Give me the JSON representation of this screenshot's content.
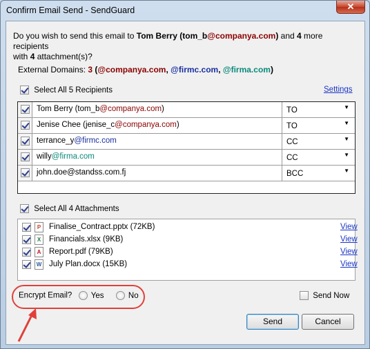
{
  "window": {
    "title": "Confirm Email Send - SendGuard",
    "close_glyph": "✕"
  },
  "prompt": {
    "pre": "Do you wish to send this email to ",
    "name": "Tom Berry",
    "open": " (tom_b",
    "domain": "@companya.com",
    "close": ")",
    "and": " and ",
    "count": "4",
    "more": " more recipients",
    "line2_pre": "with ",
    "attach_count": "4",
    "line2_post": " attachment(s)?"
  },
  "external": {
    "label": "External Domains: ",
    "count": "3",
    "open": " (",
    "d1": "@companya.com",
    "sep1": ", ",
    "d2": "@firmc.com",
    "sep2": ", ",
    "d3": "@firma.com",
    "close": ")"
  },
  "recipients_header": {
    "select_all_label": "Select All 5 Recipients",
    "checked": true,
    "settings_link": "Settings"
  },
  "recipients": [
    {
      "prefix": "Tom Berry (tom_b",
      "domain": "@companya.com",
      "suffix": ")",
      "type": "TO",
      "checked": true
    },
    {
      "prefix": "Jenise Chee (jenise_c",
      "domain": "@companya.com",
      "suffix": ")",
      "type": "TO",
      "checked": true
    },
    {
      "prefix": "terrance_y",
      "domain": "@firmc.com",
      "suffix": "",
      "type": "CC",
      "checked": true
    },
    {
      "prefix": "willy",
      "domain": "@firma.com",
      "suffix": "",
      "type": "CC",
      "checked": true
    },
    {
      "prefix": "john.doe@standss.com.fj",
      "domain": "",
      "suffix": "",
      "type": "BCC",
      "checked": true
    }
  ],
  "dropdown_glyph": "▼",
  "attachments_header": {
    "select_all_label": "Select All 4 Attachments",
    "checked": true
  },
  "attachments": [
    {
      "name": "Finalise_Contract.pptx (72KB)",
      "icon": "powerpoint-file-icon",
      "icon_letter": "P",
      "icon_color": "#c43e1c",
      "view": "View"
    },
    {
      "name": "Financials.xlsx (9KB)",
      "icon": "excel-file-icon",
      "icon_letter": "X",
      "icon_color": "#1d7a3f",
      "view": "View"
    },
    {
      "name": "Report.pdf (79KB)",
      "icon": "pdf-file-icon",
      "icon_letter": "A",
      "icon_color": "#c0141b",
      "view": "View"
    },
    {
      "name": "July Plan.docx (15KB)",
      "icon": "word-file-icon",
      "icon_letter": "W",
      "icon_color": "#2b579a",
      "view": "View"
    }
  ],
  "encrypt": {
    "label": "Encrypt Email?",
    "yes": "Yes",
    "no": "No",
    "highlight_color": "#e0403a"
  },
  "send_now": {
    "label": "Send Now",
    "checked": false
  },
  "buttons": {
    "send": "Send",
    "cancel": "Cancel"
  }
}
